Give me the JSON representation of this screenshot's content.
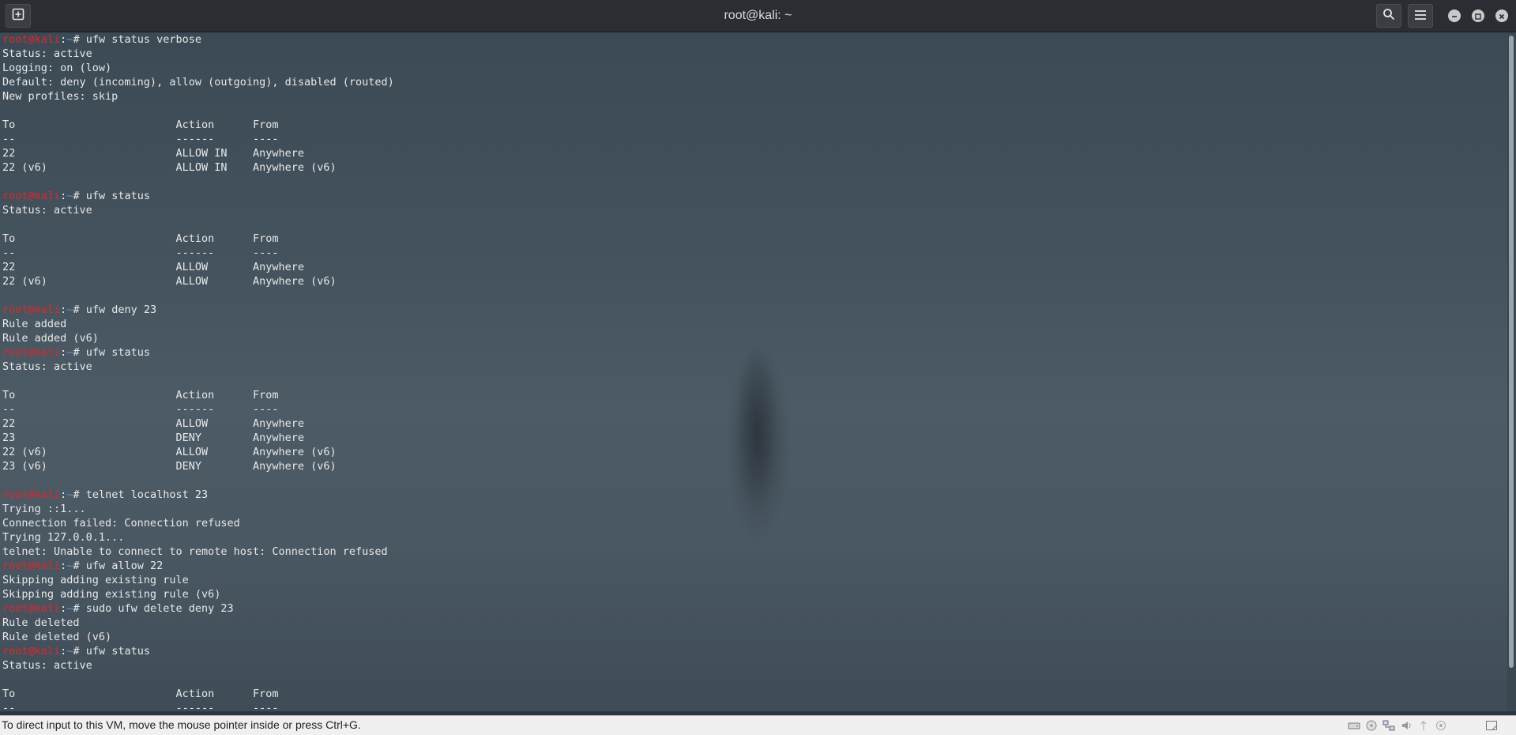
{
  "window": {
    "title": "root@kali: ~",
    "icons": [
      "new-tab-icon",
      "search-icon",
      "hamburger-menu-icon",
      "minimize-icon",
      "maximize-icon",
      "close-icon"
    ]
  },
  "prompt": {
    "user": "root@kali",
    "sep": ":",
    "dir": "~",
    "suffix": "# "
  },
  "terminal": {
    "lines": [
      {
        "type": "cmd",
        "text": "ufw status verbose"
      },
      {
        "type": "out",
        "text": "Status: active"
      },
      {
        "type": "out",
        "text": "Logging: on (low)"
      },
      {
        "type": "out",
        "text": "Default: deny (incoming), allow (outgoing), disabled (routed)"
      },
      {
        "type": "out",
        "text": "New profiles: skip"
      },
      {
        "type": "out",
        "text": ""
      },
      {
        "type": "out",
        "text": "To                         Action      From"
      },
      {
        "type": "out",
        "text": "--                         ------      ----"
      },
      {
        "type": "out",
        "text": "22                         ALLOW IN    Anywhere"
      },
      {
        "type": "out",
        "text": "22 (v6)                    ALLOW IN    Anywhere (v6)"
      },
      {
        "type": "out",
        "text": ""
      },
      {
        "type": "cmd",
        "text": "ufw status"
      },
      {
        "type": "out",
        "text": "Status: active"
      },
      {
        "type": "out",
        "text": ""
      },
      {
        "type": "out",
        "text": "To                         Action      From"
      },
      {
        "type": "out",
        "text": "--                         ------      ----"
      },
      {
        "type": "out",
        "text": "22                         ALLOW       Anywhere"
      },
      {
        "type": "out",
        "text": "22 (v6)                    ALLOW       Anywhere (v6)"
      },
      {
        "type": "out",
        "text": ""
      },
      {
        "type": "cmd",
        "text": "ufw deny 23"
      },
      {
        "type": "out",
        "text": "Rule added"
      },
      {
        "type": "out",
        "text": "Rule added (v6)"
      },
      {
        "type": "cmd",
        "text": "ufw status"
      },
      {
        "type": "out",
        "text": "Status: active"
      },
      {
        "type": "out",
        "text": ""
      },
      {
        "type": "out",
        "text": "To                         Action      From"
      },
      {
        "type": "out",
        "text": "--                         ------      ----"
      },
      {
        "type": "out",
        "text": "22                         ALLOW       Anywhere"
      },
      {
        "type": "out",
        "text": "23                         DENY        Anywhere"
      },
      {
        "type": "out",
        "text": "22 (v6)                    ALLOW       Anywhere (v6)"
      },
      {
        "type": "out",
        "text": "23 (v6)                    DENY        Anywhere (v6)"
      },
      {
        "type": "out",
        "text": ""
      },
      {
        "type": "cmd",
        "text": "telnet localhost 23"
      },
      {
        "type": "out",
        "text": "Trying ::1..."
      },
      {
        "type": "out",
        "text": "Connection failed: Connection refused"
      },
      {
        "type": "out",
        "text": "Trying 127.0.0.1..."
      },
      {
        "type": "out",
        "text": "telnet: Unable to connect to remote host: Connection refused"
      },
      {
        "type": "cmd",
        "text": "ufw allow 22"
      },
      {
        "type": "out",
        "text": "Skipping adding existing rule"
      },
      {
        "type": "out",
        "text": "Skipping adding existing rule (v6)"
      },
      {
        "type": "cmd",
        "text": "sudo ufw delete deny 23"
      },
      {
        "type": "out",
        "text": "Rule deleted"
      },
      {
        "type": "out",
        "text": "Rule deleted (v6)"
      },
      {
        "type": "cmd",
        "text": "ufw status"
      },
      {
        "type": "out",
        "text": "Status: active"
      },
      {
        "type": "out",
        "text": ""
      },
      {
        "type": "out",
        "text": "To                         Action      From"
      },
      {
        "type": "out",
        "text": "--                         ------      ----"
      }
    ]
  },
  "statusbar": {
    "message": "To direct input to this VM, move the mouse pointer inside or press Ctrl+G.",
    "icons": [
      "hard-disk-icon",
      "cd-icon",
      "network-icon",
      "audio-icon",
      "usb-icon",
      "shared-folder-icon",
      "message-icon"
    ]
  },
  "colors": {
    "prompt_user": "#e0262b",
    "prompt_dir": "#5a8fe0",
    "text": "#e8e8e8"
  }
}
